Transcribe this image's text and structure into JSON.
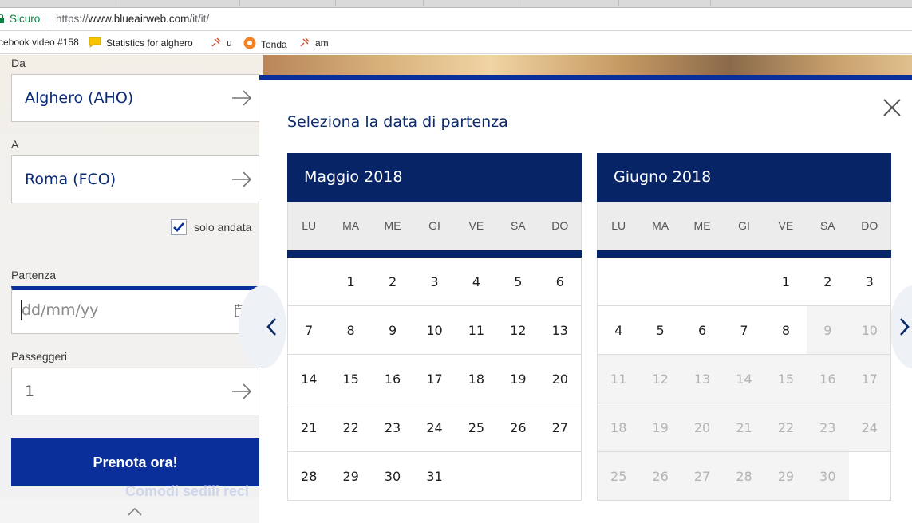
{
  "browser": {
    "secure_label": "Sicuro",
    "url_scheme": "https://",
    "url_host": "www.blueairweb.com",
    "url_path": "/it/it/",
    "bookmarks": [
      "cebook video #158",
      "Statistics for alghero",
      "u",
      "Tenda",
      "am"
    ]
  },
  "form": {
    "from_label": "Da",
    "from_value": "Alghero (AHO)",
    "to_label": "A",
    "to_value": "Roma (FCO)",
    "one_way_label": "solo andata",
    "one_way_checked": true,
    "departure_label": "Partenza",
    "departure_placeholder": "dd/mm/yy",
    "passengers_label": "Passeggeri",
    "passengers_value": "1",
    "book_button": "Prenota ora!",
    "promo_text": "Comodi sedili recl"
  },
  "datepicker": {
    "title": "Seleziona la data di partenza",
    "weekdays": [
      "LU",
      "MA",
      "ME",
      "GI",
      "VE",
      "SA",
      "DO"
    ],
    "months": [
      {
        "name": "Maggio 2018",
        "days": [
          {
            "d": "",
            "s": "empty"
          },
          {
            "d": "1",
            "s": "on"
          },
          {
            "d": "2",
            "s": "on"
          },
          {
            "d": "3",
            "s": "on"
          },
          {
            "d": "4",
            "s": "on"
          },
          {
            "d": "5",
            "s": "on"
          },
          {
            "d": "6",
            "s": "on"
          },
          {
            "d": "7",
            "s": "on"
          },
          {
            "d": "8",
            "s": "on"
          },
          {
            "d": "9",
            "s": "on"
          },
          {
            "d": "10",
            "s": "on"
          },
          {
            "d": "11",
            "s": "on"
          },
          {
            "d": "12",
            "s": "on"
          },
          {
            "d": "13",
            "s": "on"
          },
          {
            "d": "14",
            "s": "on"
          },
          {
            "d": "15",
            "s": "on"
          },
          {
            "d": "16",
            "s": "on"
          },
          {
            "d": "17",
            "s": "on"
          },
          {
            "d": "18",
            "s": "on"
          },
          {
            "d": "19",
            "s": "on"
          },
          {
            "d": "20",
            "s": "on"
          },
          {
            "d": "21",
            "s": "on"
          },
          {
            "d": "22",
            "s": "on"
          },
          {
            "d": "23",
            "s": "on"
          },
          {
            "d": "24",
            "s": "on"
          },
          {
            "d": "25",
            "s": "on"
          },
          {
            "d": "26",
            "s": "on"
          },
          {
            "d": "27",
            "s": "on"
          },
          {
            "d": "28",
            "s": "on"
          },
          {
            "d": "29",
            "s": "on"
          },
          {
            "d": "30",
            "s": "on"
          },
          {
            "d": "31",
            "s": "on"
          },
          {
            "d": "",
            "s": "empty"
          },
          {
            "d": "",
            "s": "empty"
          },
          {
            "d": "",
            "s": "empty"
          }
        ]
      },
      {
        "name": "Giugno 2018",
        "days": [
          {
            "d": "",
            "s": "empty"
          },
          {
            "d": "",
            "s": "empty"
          },
          {
            "d": "",
            "s": "empty"
          },
          {
            "d": "",
            "s": "empty"
          },
          {
            "d": "1",
            "s": "on"
          },
          {
            "d": "2",
            "s": "on"
          },
          {
            "d": "3",
            "s": "on"
          },
          {
            "d": "4",
            "s": "on"
          },
          {
            "d": "5",
            "s": "on"
          },
          {
            "d": "6",
            "s": "on"
          },
          {
            "d": "7",
            "s": "on"
          },
          {
            "d": "8",
            "s": "on"
          },
          {
            "d": "9",
            "s": "dis"
          },
          {
            "d": "10",
            "s": "dis"
          },
          {
            "d": "11",
            "s": "dis"
          },
          {
            "d": "12",
            "s": "dis"
          },
          {
            "d": "13",
            "s": "dis"
          },
          {
            "d": "14",
            "s": "dis"
          },
          {
            "d": "15",
            "s": "dis"
          },
          {
            "d": "16",
            "s": "dis"
          },
          {
            "d": "17",
            "s": "dis"
          },
          {
            "d": "18",
            "s": "dis"
          },
          {
            "d": "19",
            "s": "dis"
          },
          {
            "d": "20",
            "s": "dis"
          },
          {
            "d": "21",
            "s": "dis"
          },
          {
            "d": "22",
            "s": "dis"
          },
          {
            "d": "23",
            "s": "dis"
          },
          {
            "d": "24",
            "s": "dis"
          },
          {
            "d": "25",
            "s": "dis"
          },
          {
            "d": "26",
            "s": "dis"
          },
          {
            "d": "27",
            "s": "dis"
          },
          {
            "d": "28",
            "s": "dis"
          },
          {
            "d": "29",
            "s": "dis"
          },
          {
            "d": "30",
            "s": "dis"
          },
          {
            "d": "",
            "s": "empty"
          }
        ]
      }
    ]
  },
  "colors": {
    "brand_blue": "#0a2f9a",
    "calendar_navy": "#062466",
    "secure_green": "#0b8043"
  }
}
